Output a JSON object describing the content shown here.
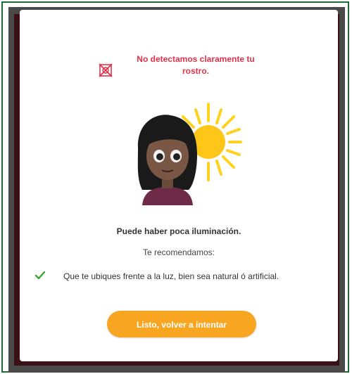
{
  "error": {
    "icon": "no-face-icon",
    "message": "No detectamos claramente tu rostro."
  },
  "illustration": {
    "icon": "face-with-sun-illustration"
  },
  "cause": "Puede haber poca iluminación.",
  "recommend_label": "Te recomendamos:",
  "tips": [
    {
      "icon": "check-icon",
      "text": "Que te ubiques frente a la luz, bien sea natural ó artificial."
    }
  ],
  "button": {
    "label": "Listo, volver a intentar"
  },
  "colors": {
    "error": "#e0324a",
    "accent": "#f8a622",
    "check": "#3aa335",
    "frame_border": "#1f6a30"
  }
}
